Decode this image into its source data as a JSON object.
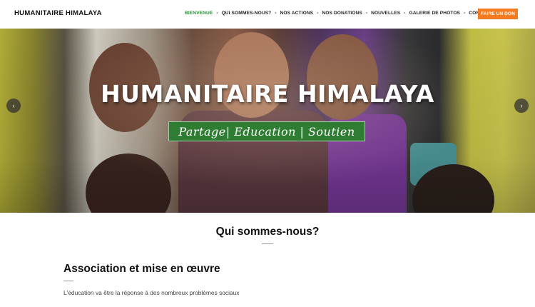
{
  "header": {
    "logo": "HUMANITAIRE HIMALAYA",
    "nav": [
      {
        "label": "BIENVENUE",
        "active": true
      },
      {
        "label": "QUI SOMMES-NOUS?",
        "active": false
      },
      {
        "label": "NOS ACTIONS",
        "active": false
      },
      {
        "label": "NOS DONATIONS",
        "active": false
      },
      {
        "label": "NOUVELLES",
        "active": false
      },
      {
        "label": "GALERIE DE PHOTOS",
        "active": false
      },
      {
        "label": "CONTACT",
        "active": false
      }
    ],
    "separator": "•",
    "donate_label": "FAIRE UN DON"
  },
  "hero": {
    "title": "HUMANITAIRE HIMALAYA",
    "tagline": "Partage| Education | Soutien",
    "prev_arrow": "‹",
    "next_arrow": "›"
  },
  "content": {
    "section_title": "Qui sommes-nous?",
    "subsection_title": "Association et mise en œuvre",
    "subsection_text": "L'éducation va être la réponse à des nombreux problèmes sociaux"
  },
  "colors": {
    "accent_green": "#2e8b3a",
    "donate_orange": "#f47b20",
    "tagline_bg": "#2f7d33"
  },
  "icons": {
    "prev": "chevron-left-icon",
    "next": "chevron-right-icon"
  }
}
